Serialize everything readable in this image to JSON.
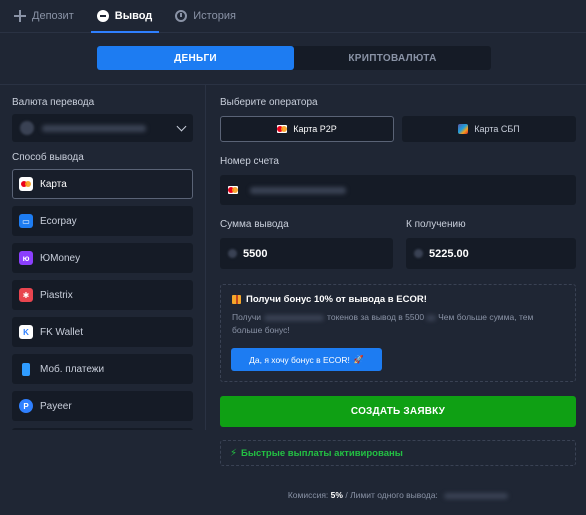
{
  "top_tabs": [
    {
      "label": "Депозит",
      "icon": "plus-icon"
    },
    {
      "label": "Вывод",
      "icon": "minus-circle-icon"
    },
    {
      "label": "История",
      "icon": "clock-icon"
    }
  ],
  "segment": {
    "money": "ДЕНЬГИ",
    "crypto": "КРИПТОВАЛЮТА"
  },
  "left": {
    "currency_label": "Валюта перевода",
    "method_label": "Способ вывода",
    "methods": [
      {
        "label": "Карта",
        "icon": "card-icon",
        "color": "#ffffff"
      },
      {
        "label": "Ecorpay",
        "icon": "ecorpay-icon",
        "color": "#1d7cf2"
      },
      {
        "label": "ЮMoney",
        "icon": "yoomoney-icon",
        "color": "#8b3ffd"
      },
      {
        "label": "Piastrix",
        "icon": "piastrix-icon",
        "color": "#e8454f"
      },
      {
        "label": "FK Wallet",
        "icon": "fk-wallet-icon",
        "color": "#2f80ff"
      },
      {
        "label": "Моб. платежи",
        "icon": "mobile-icon",
        "color": "#2f9cff"
      },
      {
        "label": "Payeer",
        "icon": "payeer-icon",
        "color": "#2f80ff"
      }
    ]
  },
  "right": {
    "operator_label": "Выберите оператора",
    "operators": [
      {
        "label": "Карта P2P",
        "icon": "mastercard-icon"
      },
      {
        "label": "Карта СБП",
        "icon": "sbp-icon"
      }
    ],
    "account_label": "Номер счета",
    "amount_label": "Сумма вывода",
    "amount_value": "5500",
    "receive_label": "К получению",
    "receive_value": "5225.00",
    "bonus": {
      "title": "Получи бонус 10% от вывода в ECOR!",
      "text_a": "Получи",
      "text_b": "токенов за вывод в 5500",
      "text_c": "Чем больше сумма, тем больше бонус!",
      "button": "Да, я хочу бонус в ECOR!"
    },
    "create_button": "СОЗДАТЬ ЗАЯВКУ",
    "fast_payouts": "Быстрые выплаты активированы",
    "footer_commission_label": "Комиссия:",
    "footer_commission_value": "5%",
    "footer_limit_label": "/ Лимит одного вывода:"
  },
  "colors": {
    "accent": "#1d7cf2",
    "success": "#0fa014",
    "success_text": "#23c043",
    "background": "#1f2634",
    "input_bg": "#151b26"
  }
}
